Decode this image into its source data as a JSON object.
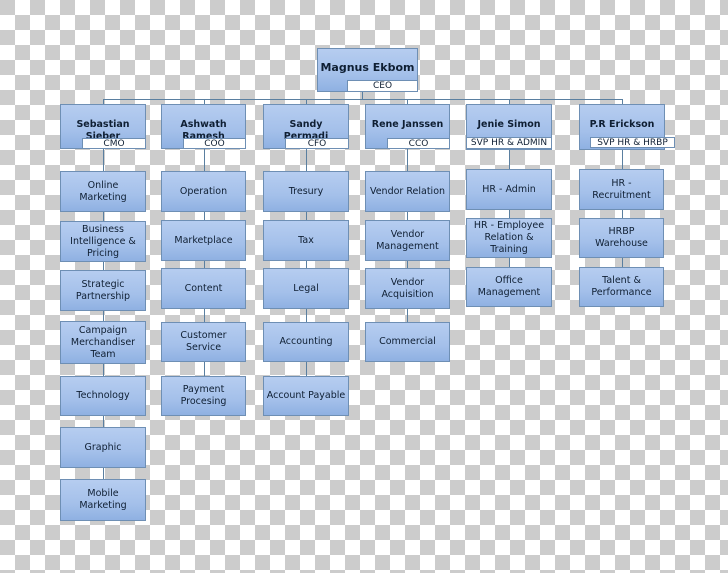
{
  "chart": {
    "ceo": {
      "name": "Magnus Ekbom",
      "title": "CEO"
    },
    "executives": [
      {
        "name": "Sebastian Sieber",
        "title": "CMO",
        "units": [
          "Online Marketing",
          "Business Intelligence & Pricing",
          "Strategic Partnership",
          "Campaign Merchandiser Team",
          "Technology",
          "Graphic",
          "Mobile Marketing"
        ]
      },
      {
        "name": "Ashwath Ramesh",
        "title": "COO",
        "units": [
          "Operation",
          "Marketplace",
          "Content",
          "Customer Service",
          "Payment Procesing"
        ]
      },
      {
        "name": "Sandy Permadi",
        "title": "CFO",
        "units": [
          "Tresury",
          "Tax",
          "Legal",
          "Accounting",
          "Account Payable"
        ]
      },
      {
        "name": "Rene Janssen",
        "title": "CCO",
        "units": [
          "Vendor Relation",
          "Vendor Management",
          "Vendor Acquisition",
          "Commercial"
        ]
      },
      {
        "name": "Jenie Simon",
        "title": "SVP HR & ADMIN",
        "units": [
          "HR - Admin",
          "HR - Employee Relation & Training",
          "Office Management"
        ]
      },
      {
        "name": "P.R Erickson",
        "title": "SVP HR & HRBP",
        "units": [
          "HR - Recruitment",
          "HRBP Warehouse",
          "Talent & Performance"
        ]
      }
    ]
  }
}
